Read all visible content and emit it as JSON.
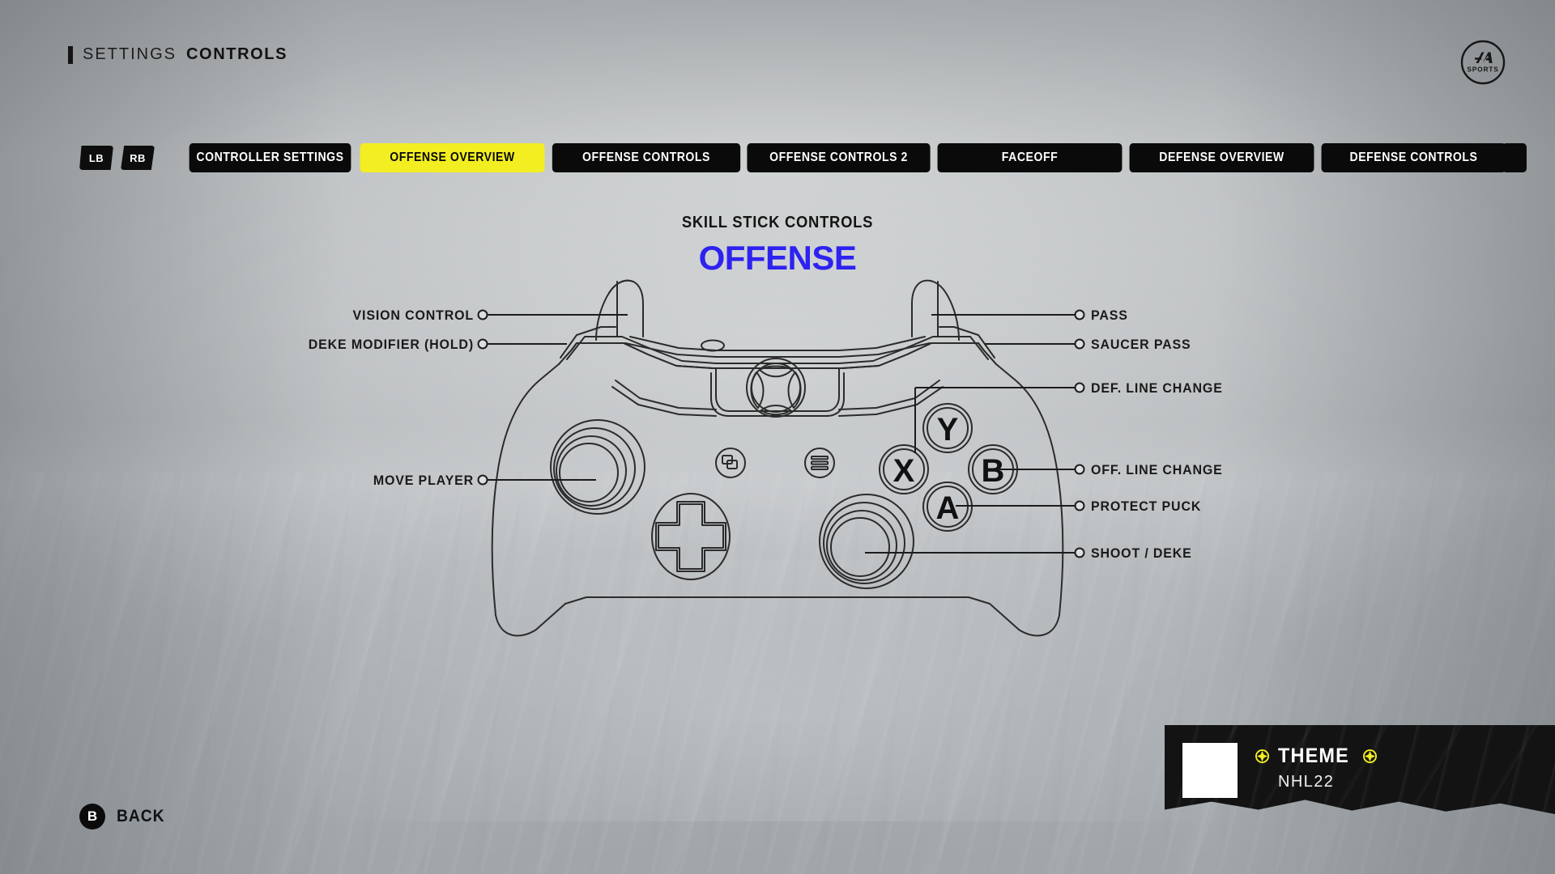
{
  "header": {
    "breadcrumb_primary": "SETTINGS",
    "breadcrumb_secondary": "CONTROLS",
    "logo_line1": "EA",
    "logo_line2": "SPORTS"
  },
  "tabbar": {
    "bumper_left": "LB",
    "bumper_right": "RB",
    "active_index": 1,
    "accent_color": "#f2ee22",
    "tabs": [
      {
        "label": "CONTROLLER SETTINGS",
        "active": false
      },
      {
        "label": "OFFENSE OVERVIEW",
        "active": true
      },
      {
        "label": "OFFENSE CONTROLS",
        "active": false
      },
      {
        "label": "OFFENSE CONTROLS 2",
        "active": false
      },
      {
        "label": "FACEOFF",
        "active": false
      },
      {
        "label": "DEFENSE OVERVIEW",
        "active": false
      },
      {
        "label": "DEFENSE CONTROLS",
        "active": false
      },
      {
        "label": "",
        "active": false
      }
    ]
  },
  "title": {
    "subtitle": "SKILL STICK CONTROLS",
    "heading": "OFFENSE",
    "heading_color": "#2d22f0"
  },
  "diagram": {
    "device": "xbox-one-controller",
    "left_callouts": [
      {
        "label": "VISION CONTROL",
        "target": "left-bumper"
      },
      {
        "label": "DEKE MODIFIER (HOLD)",
        "target": "left-trigger"
      },
      {
        "label": "MOVE PLAYER",
        "target": "left-stick"
      }
    ],
    "right_callouts": [
      {
        "label": "PASS",
        "target": "right-bumper"
      },
      {
        "label": "SAUCER PASS",
        "target": "right-trigger"
      },
      {
        "label": "DEF. LINE CHANGE",
        "target": "x-button"
      },
      {
        "label": "OFF. LINE CHANGE",
        "target": "b-button"
      },
      {
        "label": "PROTECT PUCK",
        "target": "a-button"
      },
      {
        "label": "SHOOT / DEKE",
        "target": "right-stick"
      }
    ],
    "face_buttons": [
      "Y",
      "X",
      "B",
      "A"
    ]
  },
  "footer": {
    "back_glyph": "B",
    "back_label": "BACK"
  },
  "theme_widget": {
    "title": "THEME",
    "value": "NHL22",
    "swatch_color": "#ffffff",
    "arrow_color": "#f2ee22"
  }
}
